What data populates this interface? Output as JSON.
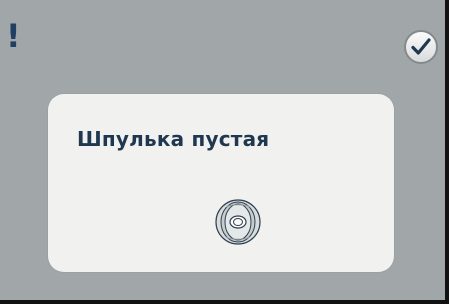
{
  "screen": {
    "alert_mark": "!"
  },
  "dialog": {
    "title": "Шпулька пустая",
    "confirm_icon": "check-icon",
    "illustration_icon": "bobbin-icon"
  },
  "colors": {
    "background": "#a1a7a8",
    "panel": "#f1f2f0",
    "text": "#20384f",
    "icon": "#1f3f63"
  }
}
